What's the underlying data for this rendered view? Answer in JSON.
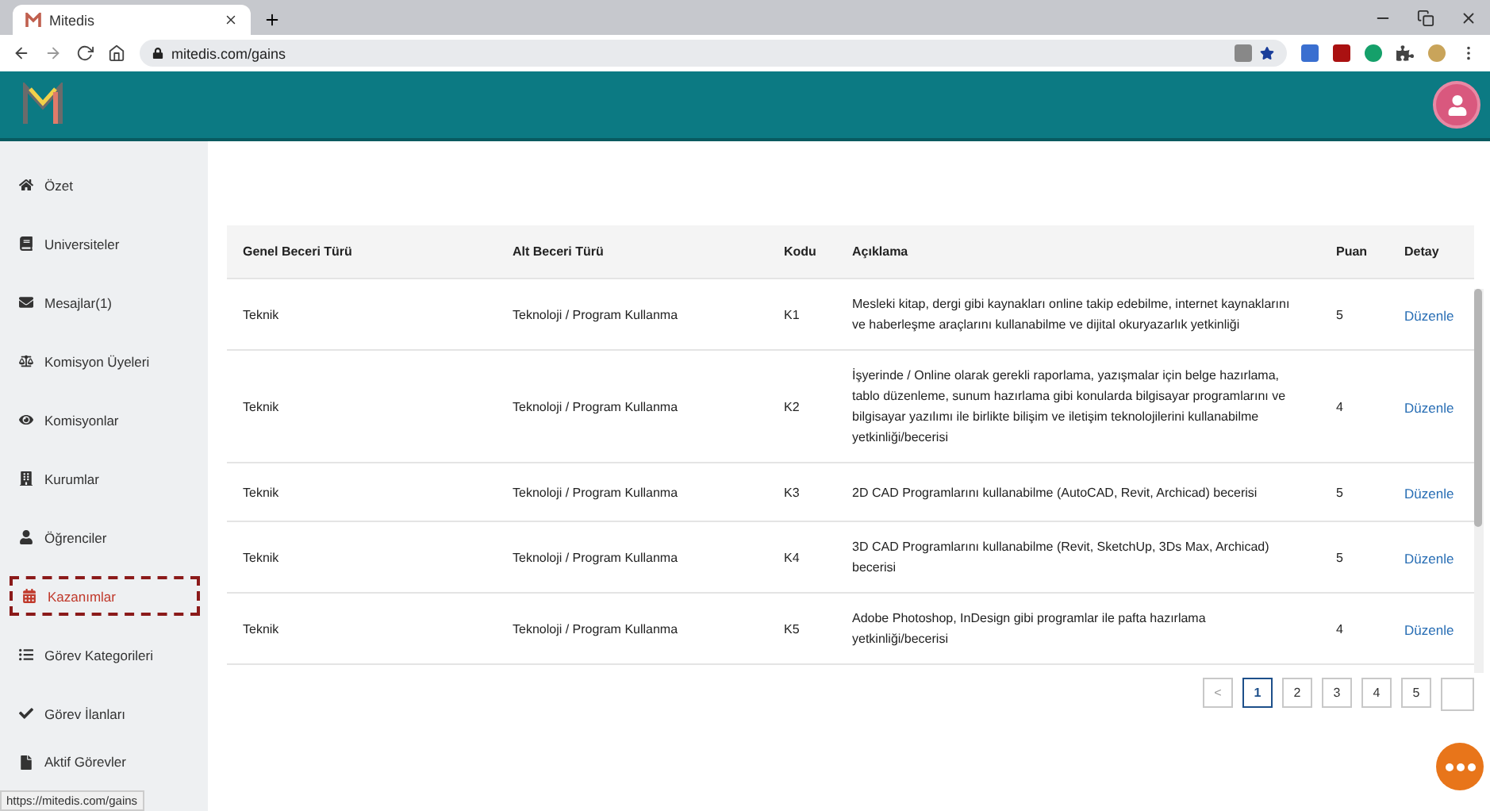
{
  "browser": {
    "tab_title": "Mitedis",
    "url": "mitedis.com/gains",
    "status_url": "https://mitedis.com/gains"
  },
  "sidebar": {
    "items": [
      {
        "label": "Özet",
        "selected": false
      },
      {
        "label": "Universiteler",
        "selected": false
      },
      {
        "label": "Mesajlar(1)",
        "selected": false
      },
      {
        "label": "Komisyon Üyeleri",
        "selected": false
      },
      {
        "label": "Komisyonlar",
        "selected": false
      },
      {
        "label": "Kurumlar",
        "selected": false
      },
      {
        "label": "Öğrenciler",
        "selected": false
      },
      {
        "label": "Kazanımlar",
        "selected": true
      },
      {
        "label": "Görev Kategorileri",
        "selected": false
      },
      {
        "label": "Görev İlanları",
        "selected": false
      },
      {
        "label": "Aktif Görevler",
        "selected": false
      }
    ]
  },
  "table": {
    "columns": [
      "Genel Beceri Türü",
      "Alt Beceri Türü",
      "Kodu",
      "Açıklama",
      "Puan",
      "Detay"
    ],
    "rows": [
      {
        "general": "Teknik",
        "sub": "Teknoloji / Program Kullanma",
        "code": "K1",
        "description": "Mesleki kitap, dergi gibi kaynakları online takip edebilme, internet kaynaklarını ve haberleşme araçlarını kullanabilme ve dijital okuryazarlık yetkinliği",
        "points": "5",
        "action": "Düzenle"
      },
      {
        "general": "Teknik",
        "sub": "Teknoloji / Program Kullanma",
        "code": "K2",
        "description": "İşyerinde / Online olarak gerekli raporlama, yazışmalar için belge hazırlama, tablo düzenleme, sunum hazırlama gibi konularda bilgisayar programlarını ve bilgisayar yazılımı ile birlikte bilişim ve iletişim teknolojilerini kullanabilme yetkinliği/becerisi",
        "points": "4",
        "action": "Düzenle"
      },
      {
        "general": "Teknik",
        "sub": "Teknoloji / Program Kullanma",
        "code": "K3",
        "description": "2D CAD Programlarını kullanabilme (AutoCAD, Revit, Archicad) becerisi",
        "points": "5",
        "action": "Düzenle"
      },
      {
        "general": "Teknik",
        "sub": "Teknoloji / Program Kullanma",
        "code": "K4",
        "description": "3D CAD Programlarını kullanabilme (Revit, SketchUp, 3Ds Max, Archicad) becerisi",
        "points": "5",
        "action": "Düzenle"
      },
      {
        "general": "Teknik",
        "sub": "Teknoloji / Program Kullanma",
        "code": "K5",
        "description": "Adobe Photoshop, InDesign gibi programlar ile pafta hazırlama yetkinliği/becerisi",
        "points": "4",
        "action": "Düzenle"
      }
    ]
  },
  "pagination": {
    "prev": "<",
    "pages": [
      {
        "label": "1",
        "selected": true
      },
      {
        "label": "2",
        "selected": false
      },
      {
        "label": "3",
        "selected": false
      },
      {
        "label": "4",
        "selected": false
      },
      {
        "label": "5",
        "selected": false
      }
    ]
  }
}
